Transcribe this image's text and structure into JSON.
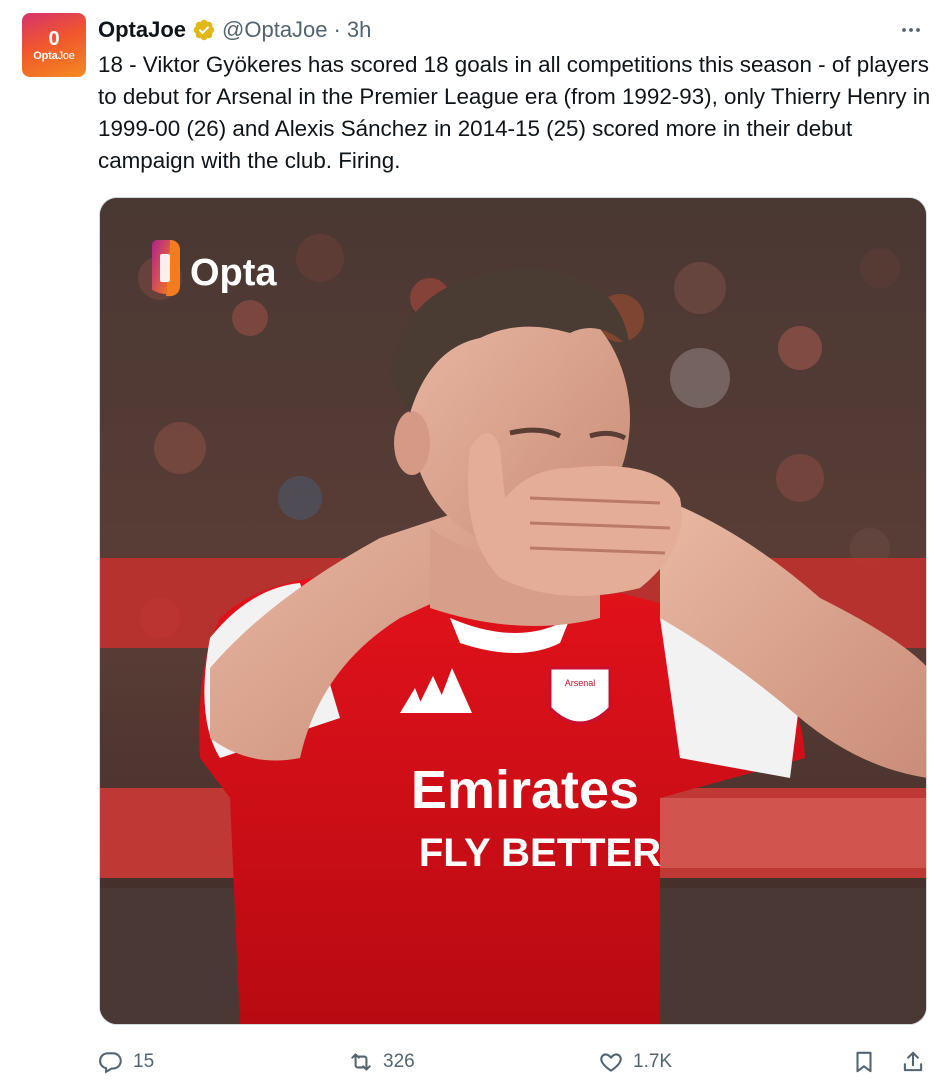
{
  "tweet": {
    "avatar": {
      "mark": "0",
      "brand_prefix": "Opta",
      "brand_suffix": "Joe"
    },
    "display_name": "OptaJoe",
    "handle": "@OptaJoe",
    "separator": "·",
    "time": "3h",
    "text": "18 - Viktor Gyökeres has scored 18 goals in all competitions this season - of players to debut for Arsenal in the Premier League era (from 1992-93), only Thierry Henry in 1999-00 (26) and Alexis Sánchez in 2014-15 (25) scored more in their debut campaign with the club. Firing.",
    "media": {
      "logo_text": "Opta",
      "shirt_sponsor_line1": "Emirates",
      "shirt_sponsor_line2": "FLY BETTER",
      "crest_text": "Arsenal"
    },
    "actions": {
      "reply_count": "15",
      "retweet_count": "326",
      "like_count": "1.7K"
    }
  },
  "icons": {
    "verified": "verified-badge-icon",
    "more": "more-icon",
    "reply": "reply-icon",
    "retweet": "retweet-icon",
    "like": "like-icon",
    "bookmark": "bookmark-icon",
    "share": "share-icon"
  },
  "colors": {
    "verified_gold": "#e2b719",
    "muted_text": "#536471",
    "arsenal_red": "#db0007",
    "opta_orange": "#f47b20",
    "opta_purple": "#b0228c"
  }
}
